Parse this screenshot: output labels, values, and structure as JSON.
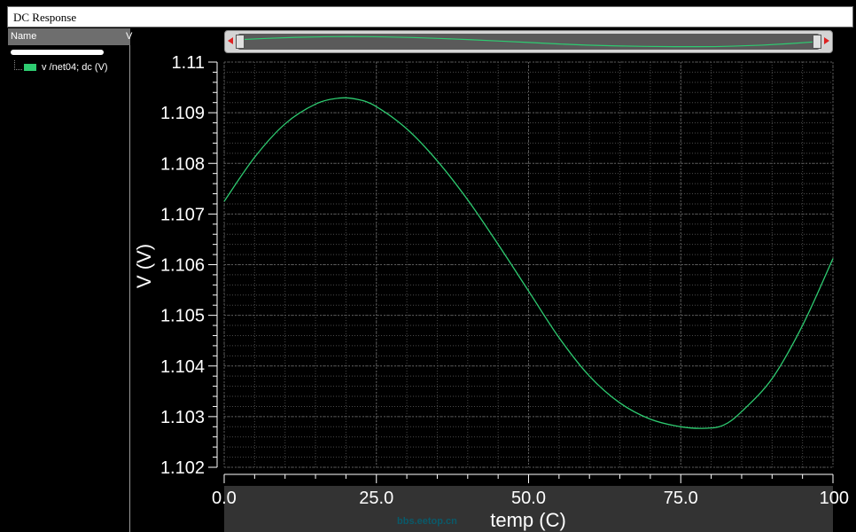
{
  "window": {
    "title": "DC Response"
  },
  "panel": {
    "column_name": "Name",
    "column_v": "V",
    "traces": [
      {
        "label": "v /net04; dc (V)",
        "color": "#2ecc71"
      }
    ]
  },
  "watermark": "bbs.eetop.cn",
  "colors": {
    "background": "#000000",
    "grid": "#4a4a4a",
    "trace": "#2ecc71",
    "text": "#ffffff"
  },
  "chart_data": {
    "type": "line",
    "xlabel": "temp (C)",
    "ylabel": "V (V)",
    "xlim": [
      0,
      100
    ],
    "ylim": [
      1.102,
      1.11
    ],
    "xticks": [
      0,
      25,
      50,
      75,
      100
    ],
    "xtick_labels": [
      "0.0",
      "25.0",
      "50.0",
      "75.0",
      "100"
    ],
    "yticks": [
      1.102,
      1.103,
      1.104,
      1.105,
      1.106,
      1.107,
      1.108,
      1.109,
      1.11
    ],
    "ytick_labels": [
      "1.102",
      "1.103",
      "1.104",
      "1.105",
      "1.106",
      "1.107",
      "1.108",
      "1.109",
      "1.11"
    ],
    "grid": true,
    "series": [
      {
        "name": "v /net04; dc (V)",
        "color": "#2ecc71",
        "x": [
          0,
          5,
          10,
          15,
          19,
          22,
          25,
          30,
          35,
          40,
          45,
          50,
          55,
          60,
          65,
          70,
          75,
          79,
          82,
          85,
          90,
          95,
          100
        ],
        "y": [
          1.10725,
          1.10812,
          1.10878,
          1.10917,
          1.10929,
          1.10926,
          1.10912,
          1.10868,
          1.10805,
          1.10728,
          1.1064,
          1.10548,
          1.10456,
          1.1038,
          1.10327,
          1.10295,
          1.1028,
          1.10277,
          1.10283,
          1.1031,
          1.10375,
          1.1048,
          1.10612
        ]
      }
    ]
  }
}
